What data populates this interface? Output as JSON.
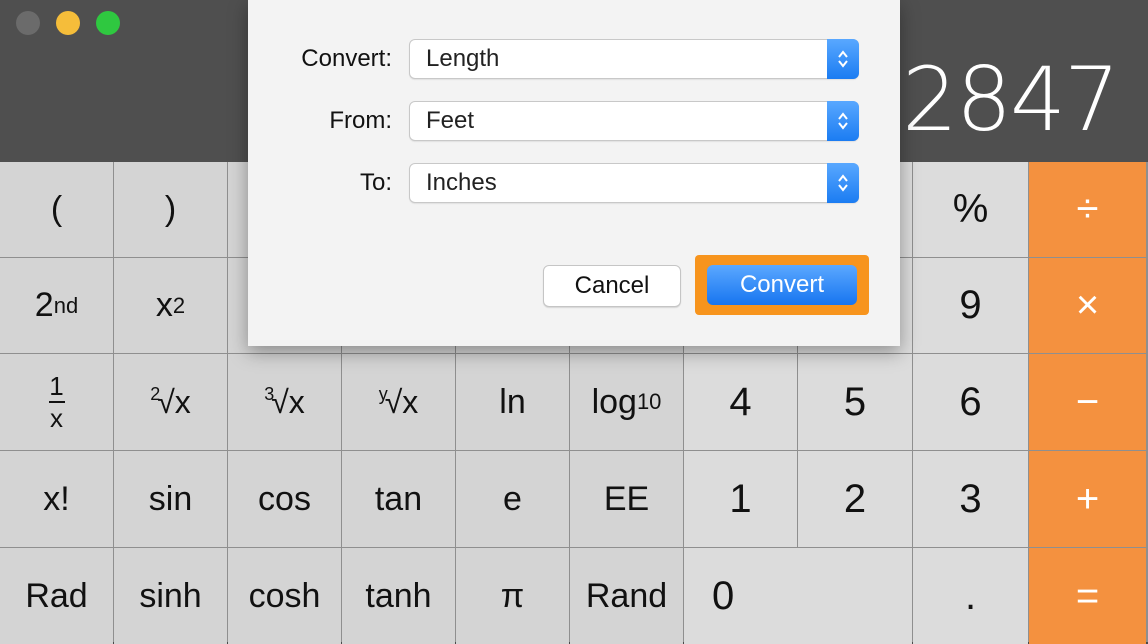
{
  "display": {
    "value": "2847"
  },
  "dialog": {
    "convert_label": "Convert:",
    "convert_value": "Length",
    "from_label": "From:",
    "from_value": "Feet",
    "to_label": "To:",
    "to_value": "Inches",
    "cancel_label": "Cancel",
    "convert_button_label": "Convert"
  },
  "keys": {
    "lparen": "(",
    "rparen": ")",
    "percent": "%",
    "divide": "÷",
    "second_base": "2",
    "second_sup": "nd",
    "xsq_base": "x",
    "xsq_sup": "2",
    "nine": "9",
    "multiply": "×",
    "recip_num": "1",
    "recip_den": "x",
    "sqrt2_idx": "2",
    "sqrt2_body": "√x",
    "sqrt3_idx": "3",
    "sqrt3_body": "√x",
    "sqrty_idx": "y",
    "sqrty_body": "√x",
    "ln": "ln",
    "log_base": "log",
    "log_sub": "10",
    "four": "4",
    "five": "5",
    "six": "6",
    "minus": "−",
    "fact": "x!",
    "sin": "sin",
    "cos": "cos",
    "tan": "tan",
    "e": "e",
    "ee": "EE",
    "one": "1",
    "two": "2",
    "three": "3",
    "plus": "+",
    "rad": "Rad",
    "sinh": "sinh",
    "cosh": "cosh",
    "tanh": "tanh",
    "pi": "π",
    "rand": "Rand",
    "zero": "0",
    "dot": ".",
    "equals": "="
  },
  "colors": {
    "operator": "#f4913f",
    "accent": "#1b7cf2",
    "focus": "#f7941d"
  }
}
